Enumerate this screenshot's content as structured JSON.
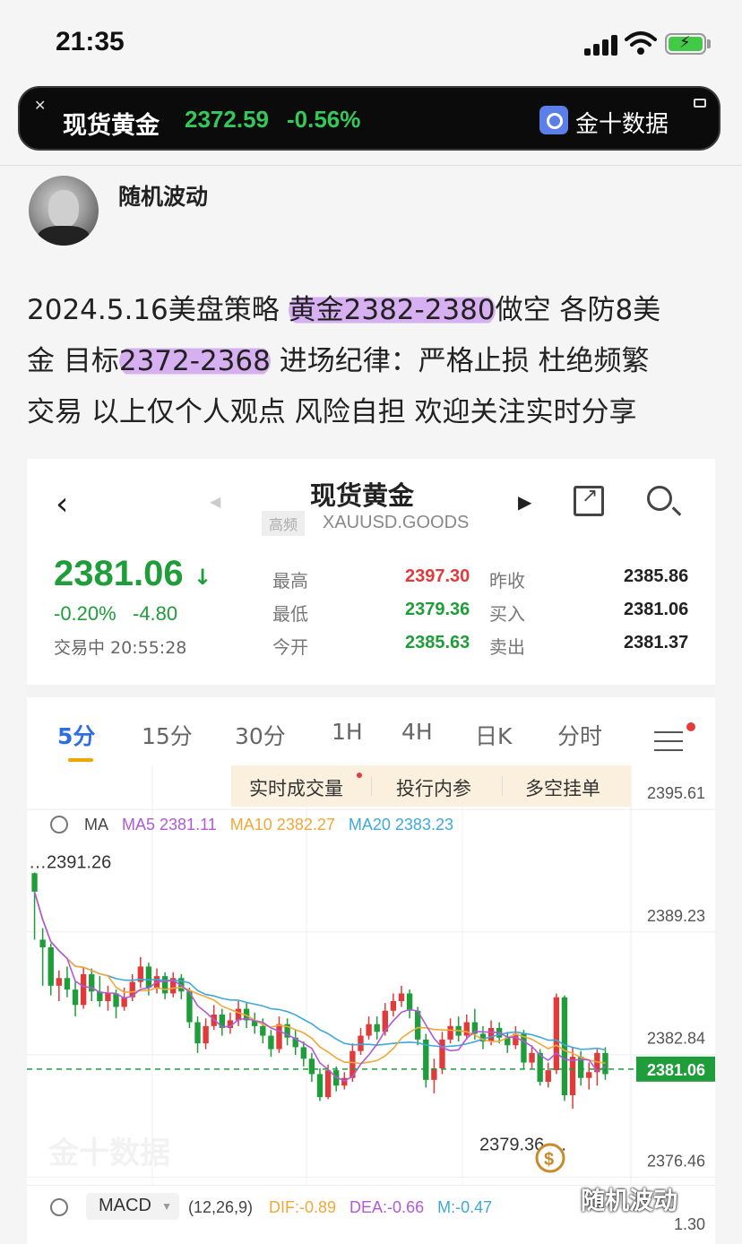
{
  "status_bar": {
    "time": "21:35"
  },
  "ticker": {
    "name": "现货黄金",
    "price": "2372.59",
    "change_pct": "-0.56%",
    "brand": "金十数据"
  },
  "post": {
    "username": "随机波动",
    "text": {
      "l1a": "2024.5.16美盘策略 ",
      "l1b": "黄金2382-2380",
      "l1c": "做空 各防8美",
      "l2a": "金 目标",
      "l2b": "2372-2368",
      "l2c": " 进场纪律：严格止损 杜绝频繁",
      "l3": "交易 以上仅个人观点 风险自担 欢迎关注实时分享"
    }
  },
  "app": {
    "title": "现货黄金",
    "tag": "高频",
    "code": "XAUUSD.GOODS",
    "price": "2381.06",
    "change_pct": "-0.20%",
    "change_abs": "-4.80",
    "trade_status": "交易中 20:55:28",
    "quotes": {
      "high_label": "最高",
      "high": "2397.30",
      "low_label": "最低",
      "low": "2379.36",
      "open_label": "今开",
      "open": "2385.63",
      "prev_close_label": "昨收",
      "prev_close": "2385.86",
      "bid_label": "买入",
      "bid": "2381.06",
      "ask_label": "卖出",
      "ask": "2381.37"
    },
    "tabs": [
      "5分",
      "15分",
      "30分",
      "1H",
      "4H",
      "日K",
      "分时"
    ],
    "sub_tabs": [
      "实时成交量",
      "投行内参",
      "多空挂单"
    ],
    "ma": {
      "label": "MA",
      "ma5": "MA5 2381.11",
      "ma10": "MA10 2382.27",
      "ma20": "MA20 2383.23"
    },
    "macd": {
      "label": "MACD",
      "params": "(12,26,9)",
      "dif": "DIF:-0.89",
      "dea": "DEA:-0.66",
      "m": "M:-0.47",
      "tick": "1.30"
    },
    "watermark_brand": "金十数据"
  },
  "colors": {
    "up": "#e03a3a",
    "down": "#1f9d3a",
    "ma5": "#b05ad8",
    "ma10": "#f0a83a",
    "ma20": "#3ea9d8",
    "accent": "#2d6fe0"
  },
  "chart_data": {
    "type": "candlestick",
    "y_ticks": [
      2395.61,
      2389.23,
      2382.84,
      2376.46
    ],
    "ylim": [
      2375.5,
      2396.5
    ],
    "high_label": "2391.26",
    "low_label": "2379.36",
    "current_price": "2381.06",
    "candles": [
      [
        2391.26,
        2390.3,
        2391.3,
        2387.8
      ],
      [
        2387.8,
        2387.4,
        2388.4,
        2385.4
      ],
      [
        2387.4,
        2385.4,
        2387.6,
        2384.9
      ],
      [
        2385.4,
        2385.8,
        2386.2,
        2384.6
      ],
      [
        2385.8,
        2385.2,
        2386.4,
        2384.8
      ],
      [
        2385.2,
        2384.4,
        2385.6,
        2383.8
      ],
      [
        2384.4,
        2386.0,
        2386.4,
        2384.2
      ],
      [
        2386.0,
        2385.1,
        2386.3,
        2384.6
      ],
      [
        2385.1,
        2384.6,
        2385.9,
        2384.3
      ],
      [
        2384.6,
        2385.0,
        2385.4,
        2384.1
      ],
      [
        2385.0,
        2384.3,
        2385.2,
        2383.7
      ],
      [
        2384.3,
        2384.8,
        2385.3,
        2384.1
      ],
      [
        2384.8,
        2385.6,
        2386.0,
        2384.6
      ],
      [
        2385.6,
        2386.4,
        2386.9,
        2385.3
      ],
      [
        2386.4,
        2385.3,
        2386.6,
        2384.9
      ],
      [
        2385.3,
        2385.9,
        2386.3,
        2385.0
      ],
      [
        2385.9,
        2385.0,
        2386.1,
        2384.7
      ],
      [
        2385.0,
        2385.8,
        2386.1,
        2384.8
      ],
      [
        2385.8,
        2385.1,
        2386.0,
        2384.7
      ],
      [
        2385.1,
        2383.5,
        2385.3,
        2383.2
      ],
      [
        2383.5,
        2382.4,
        2383.8,
        2381.9
      ],
      [
        2382.4,
        2383.3,
        2383.7,
        2382.1
      ],
      [
        2383.3,
        2383.9,
        2384.4,
        2383.1
      ],
      [
        2383.9,
        2383.2,
        2384.2,
        2382.8
      ],
      [
        2383.2,
        2383.6,
        2384.0,
        2382.9
      ],
      [
        2383.6,
        2384.2,
        2384.6,
        2383.3
      ],
      [
        2384.2,
        2383.6,
        2384.5,
        2383.2
      ],
      [
        2383.6,
        2383.3,
        2384.0,
        2382.9
      ],
      [
        2383.3,
        2382.8,
        2383.7,
        2382.4
      ],
      [
        2382.8,
        2382.1,
        2383.1,
        2381.7
      ],
      [
        2382.1,
        2383.4,
        2383.8,
        2381.9
      ],
      [
        2383.4,
        2382.7,
        2383.7,
        2382.3
      ],
      [
        2382.7,
        2382.2,
        2383.1,
        2381.8
      ],
      [
        2382.2,
        2381.6,
        2382.5,
        2381.2
      ],
      [
        2381.6,
        2380.8,
        2381.9,
        2380.4
      ],
      [
        2380.8,
        2379.6,
        2381.1,
        2379.4
      ],
      [
        2379.6,
        2381.0,
        2381.3,
        2379.5
      ],
      [
        2381.0,
        2380.2,
        2381.2,
        2379.9
      ],
      [
        2380.2,
        2380.6,
        2380.9,
        2380.0
      ],
      [
        2380.6,
        2382.0,
        2382.4,
        2380.4
      ],
      [
        2382.0,
        2382.8,
        2383.2,
        2381.8
      ],
      [
        2382.8,
        2383.4,
        2383.8,
        2382.6
      ],
      [
        2383.4,
        2383.0,
        2383.8,
        2382.6
      ],
      [
        2383.0,
        2384.1,
        2384.5,
        2382.8
      ],
      [
        2384.1,
        2384.6,
        2385.0,
        2383.8
      ],
      [
        2384.6,
        2385.0,
        2385.4,
        2384.3
      ],
      [
        2385.0,
        2384.1,
        2385.2,
        2383.7
      ],
      [
        2384.1,
        2382.6,
        2384.3,
        2382.3
      ],
      [
        2382.6,
        2380.5,
        2382.9,
        2380.1
      ],
      [
        2380.5,
        2381.1,
        2381.6,
        2379.8
      ],
      [
        2381.1,
        2382.6,
        2383.0,
        2380.8
      ],
      [
        2382.6,
        2383.3,
        2383.7,
        2382.4
      ],
      [
        2383.3,
        2382.8,
        2383.8,
        2382.5
      ],
      [
        2382.8,
        2383.5,
        2383.9,
        2382.6
      ],
      [
        2383.5,
        2382.9,
        2384.2,
        2382.6
      ],
      [
        2382.9,
        2382.5,
        2383.3,
        2382.1
      ],
      [
        2382.5,
        2383.2,
        2383.6,
        2382.3
      ],
      [
        2383.2,
        2382.7,
        2383.5,
        2382.4
      ],
      [
        2382.7,
        2382.3,
        2383.0,
        2381.9
      ],
      [
        2382.3,
        2382.9,
        2383.3,
        2382.1
      ],
      [
        2382.9,
        2381.4,
        2383.1,
        2381.1
      ],
      [
        2381.4,
        2381.9,
        2382.3,
        2381.1
      ],
      [
        2381.9,
        2380.4,
        2382.1,
        2380.2
      ],
      [
        2380.4,
        2381.0,
        2381.4,
        2380.1
      ],
      [
        2381.0,
        2384.8,
        2385.0,
        2380.8
      ],
      [
        2384.8,
        2379.7,
        2384.9,
        2379.4
      ],
      [
        2379.7,
        2381.7,
        2382.2,
        2379.0
      ],
      [
        2381.7,
        2380.6,
        2382.0,
        2380.2
      ],
      [
        2380.6,
        2380.9,
        2381.4,
        2380.0
      ],
      [
        2380.9,
        2381.9,
        2382.1,
        2380.2
      ],
      [
        2381.9,
        2380.8,
        2382.2,
        2380.5
      ]
    ]
  }
}
